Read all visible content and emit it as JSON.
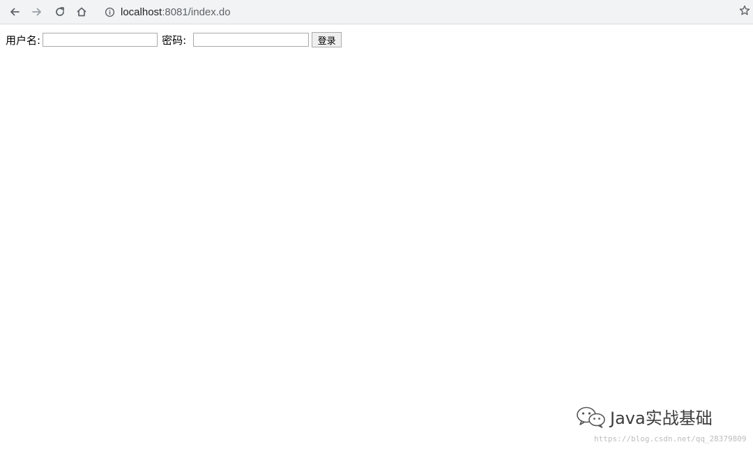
{
  "browser": {
    "url_host": "localhost",
    "url_rest": ":8081/index.do",
    "icons": [
      "back-icon",
      "forward-icon",
      "reload-icon",
      "home-icon",
      "info-icon",
      "star-icon"
    ]
  },
  "login_form": {
    "username_label": "用户名:",
    "username_value": "",
    "password_label": "密码:",
    "password_value": "",
    "submit_label": "登录"
  },
  "watermark": {
    "text": "Java实战基础",
    "source_url": "https://blog.csdn.net/qq_28379809"
  },
  "colors": {
    "toolbar_bg": "#f1f3f4",
    "page_bg": "#ffffff"
  }
}
